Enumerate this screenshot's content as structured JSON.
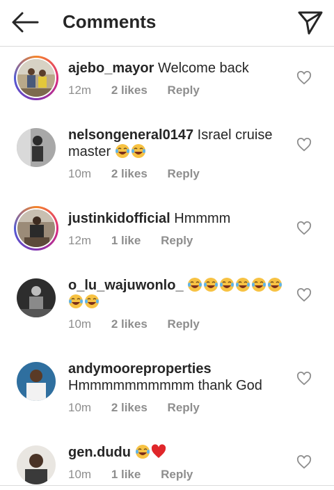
{
  "header": {
    "title": "Comments",
    "back_icon": "arrow-left-icon",
    "send_icon": "paper-plane-icon"
  },
  "colors": {
    "text": "#262626",
    "meta": "#8e8e8e",
    "divider": "#dbdbdb",
    "emoji": "#f7c243",
    "heart_red": "#e0262a"
  },
  "comments": [
    {
      "username": "ajebo_mayor",
      "text": "Welcome back",
      "time": "12m",
      "likes": "2 likes",
      "reply": "Reply"
    },
    {
      "username": "nelsongeneral0147",
      "text": "Israel cruise master",
      "time": "10m",
      "likes": "2 likes",
      "reply": "Reply"
    },
    {
      "username": "justinkidofficial",
      "text": "Hmmmm",
      "time": "12m",
      "likes": "1 like",
      "reply": "Reply"
    },
    {
      "username": "o_lu_wajuwonlo_",
      "text": "",
      "time": "10m",
      "likes": "2 likes",
      "reply": "Reply"
    },
    {
      "username": "andymooreproperties",
      "text": "Hmmmmmmmmmm thank God",
      "time": "10m",
      "likes": "2 likes",
      "reply": "Reply"
    },
    {
      "username": "gen.dudu",
      "text": "",
      "time": "10m",
      "likes": "1 like",
      "reply": "Reply"
    }
  ]
}
